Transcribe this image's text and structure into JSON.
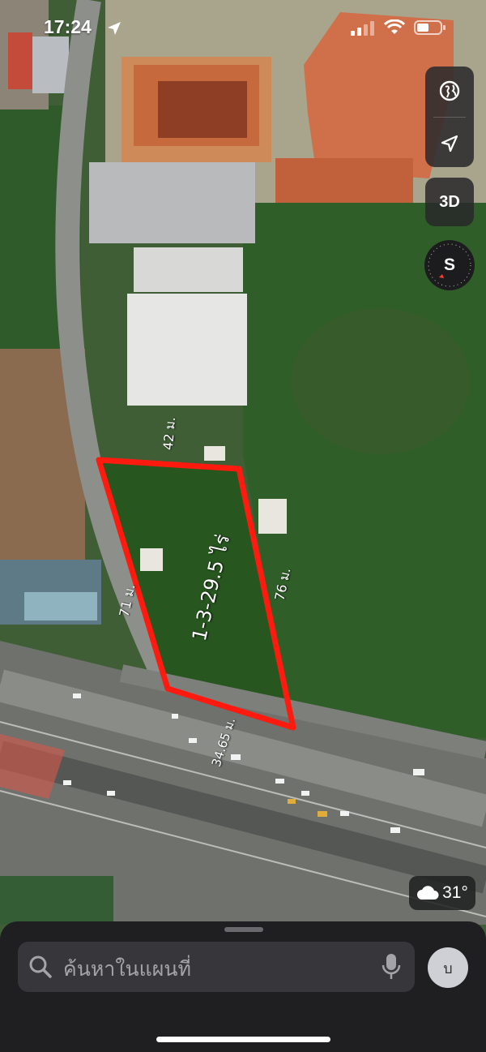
{
  "status": {
    "time": "17:24"
  },
  "map_controls": {
    "view_3d_label": "3D",
    "compass_label": "S"
  },
  "plot": {
    "area_label": "1-3-29.5 ไร่",
    "dim_top": "42 ม.",
    "dim_left": "71 ม.",
    "dim_right": "76 ม.",
    "dim_bottom": "34.65 ม."
  },
  "weather": {
    "temperature": "31°"
  },
  "search": {
    "placeholder": "ค้นหาในแผนที่"
  },
  "account": {
    "initial": "บ"
  },
  "colors": {
    "plot_outline": "#ff1a0f",
    "sheet": "#1f1f21",
    "field": "#2f5a2a"
  }
}
